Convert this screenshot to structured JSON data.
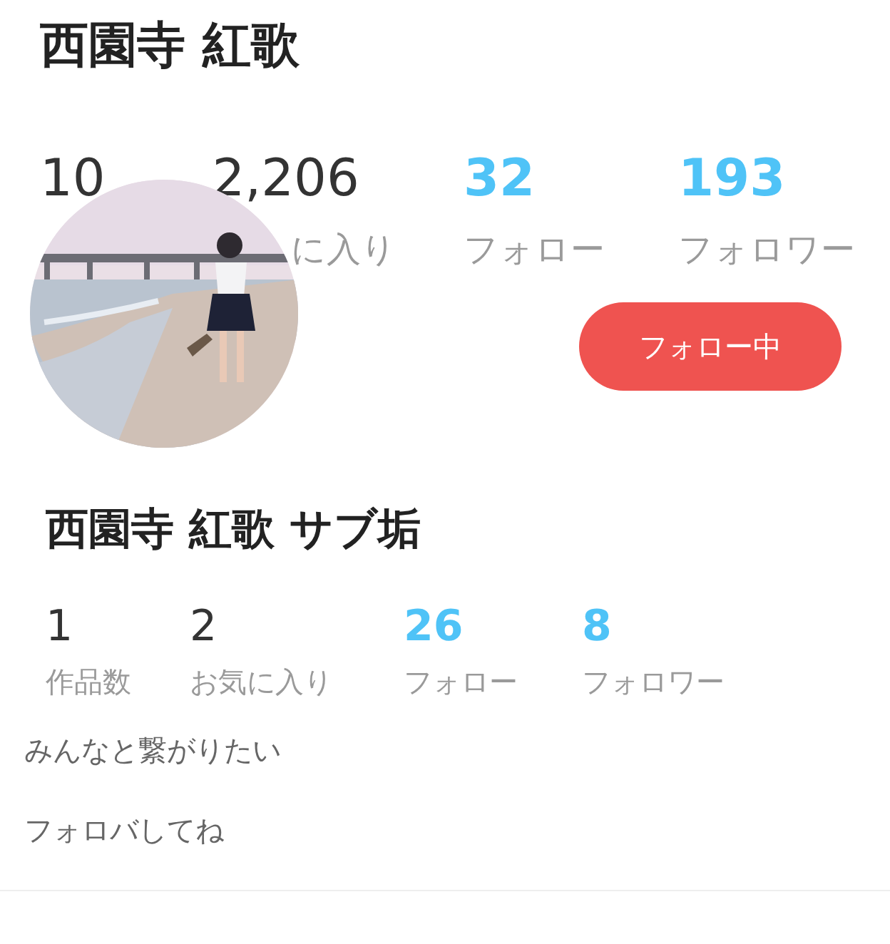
{
  "profile": {
    "name": "西園寺 紅歌",
    "stats": [
      {
        "kind": "plain",
        "value": "10"
      },
      {
        "kind": "plain",
        "value": "2,206",
        "label": "に入り"
      },
      {
        "kind": "accent",
        "value": "32",
        "label": "フォロー"
      },
      {
        "kind": "accent",
        "value": "193",
        "label": "フォロワー"
      }
    ],
    "follow_button": "フォロー中"
  },
  "sub_account": {
    "name": "西園寺 紅歌 サブ垢",
    "stats": [
      {
        "kind": "plain",
        "value": "1",
        "label": "作品数"
      },
      {
        "kind": "plain",
        "value": "2",
        "label": "お気に入り"
      },
      {
        "kind": "accent",
        "value": "26",
        "label": "フォロー"
      },
      {
        "kind": "accent",
        "value": "8",
        "label": "フォロワー"
      }
    ],
    "bio": [
      "みんなと繋がりたい",
      "フォロバしてね"
    ]
  }
}
